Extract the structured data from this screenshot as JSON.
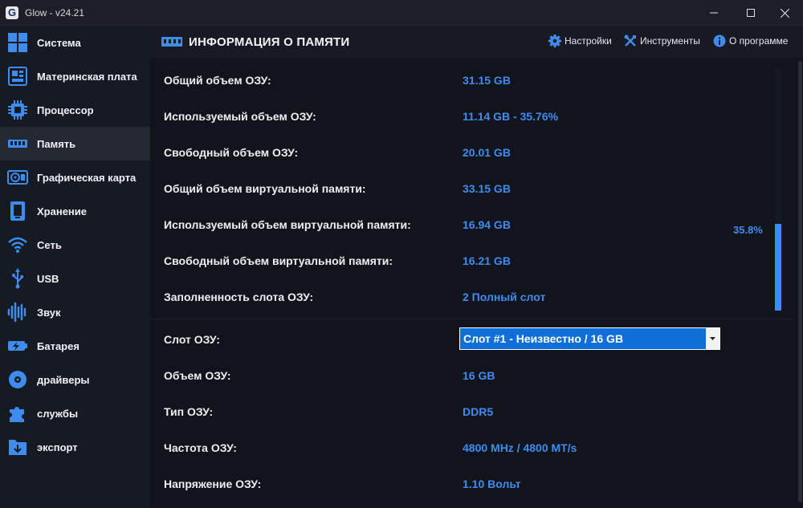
{
  "window": {
    "app_icon_letter": "G",
    "title": "Glow - v24.21"
  },
  "sidebar": {
    "items": [
      {
        "label": "Система",
        "icon": "windows-icon",
        "active": false
      },
      {
        "label": "Материнская плата",
        "icon": "motherboard-icon",
        "active": false
      },
      {
        "label": "Процессор",
        "icon": "cpu-icon",
        "active": false
      },
      {
        "label": "Память",
        "icon": "ram-icon",
        "active": true
      },
      {
        "label": "Графическая карта",
        "icon": "gpu-icon",
        "active": false
      },
      {
        "label": "Хранение",
        "icon": "storage-icon",
        "active": false
      },
      {
        "label": "Сеть",
        "icon": "wifi-icon",
        "active": false
      },
      {
        "label": "USB",
        "icon": "usb-icon",
        "active": false
      },
      {
        "label": "Звук",
        "icon": "sound-wave-icon",
        "active": false
      },
      {
        "label": "Батарея",
        "icon": "battery-icon",
        "active": false
      },
      {
        "label": "драйверы",
        "icon": "disc-icon",
        "active": false
      },
      {
        "label": "службы",
        "icon": "puzzle-icon",
        "active": false
      },
      {
        "label": "экспорт",
        "icon": "export-icon",
        "active": false
      }
    ]
  },
  "header": {
    "title": "ИНФОРМАЦИЯ О ПАМЯТИ",
    "settings_label": "Настройки",
    "tools_label": "Инструменты",
    "about_label": "О программе"
  },
  "memory": {
    "rows": [
      {
        "label": "Общий объем ОЗУ:",
        "value": "31.15 GB"
      },
      {
        "label": "Используемый объем ОЗУ:",
        "value": "11.14 GB - 35.76%"
      },
      {
        "label": "Свободный объем ОЗУ:",
        "value": "20.01 GB"
      },
      {
        "label": "Общий объем виртуальной памяти:",
        "value": "33.15 GB"
      },
      {
        "label": "Используемый объем виртуальной памяти:",
        "value": "16.94 GB"
      },
      {
        "label": "Свободный объем виртуальной памяти:",
        "value": "16.21 GB"
      },
      {
        "label": "Заполненность слота ОЗУ:",
        "value": "2 Полный слот"
      }
    ],
    "usage_percent_text": "35.8%",
    "usage_fraction": 0.358
  },
  "slot": {
    "label": "Слот ОЗУ:",
    "selected": "Слот #1 - Неизвестно / 16 GB",
    "rows": [
      {
        "label": "Объем ОЗУ:",
        "value": "16 GB"
      },
      {
        "label": "Тип ОЗУ:",
        "value": "DDR5"
      },
      {
        "label": "Частота ОЗУ:",
        "value": "4800 MHz / 4800 MT/s"
      },
      {
        "label": "Напряжение ОЗУ:",
        "value": "1.10 Вольт"
      }
    ]
  },
  "colors": {
    "accent": "#3f8cf0",
    "background": "#12141b",
    "sidebar": "#161a22",
    "active_item": "#242832"
  }
}
